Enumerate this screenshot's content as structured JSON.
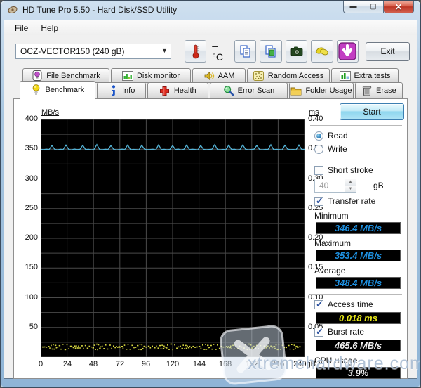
{
  "window": {
    "title": "HD Tune Pro 5.50 - Hard Disk/SSD Utility"
  },
  "menu": {
    "items": [
      "File",
      "Help"
    ]
  },
  "toolbar": {
    "drive": "OCZ-VECTOR150 (240 gB)",
    "temperature": "– °C",
    "exit_label": "Exit"
  },
  "tabs_row1": [
    {
      "id": "file-benchmark",
      "label": "File Benchmark",
      "icon": "lamp-purple",
      "active": false
    },
    {
      "id": "disk-monitor",
      "label": "Disk monitor",
      "icon": "chart-bars",
      "active": false
    },
    {
      "id": "aam",
      "label": "AAM",
      "icon": "speaker",
      "active": false
    },
    {
      "id": "random-access",
      "label": "Random Access",
      "icon": "dots",
      "active": false
    },
    {
      "id": "extra-tests",
      "label": "Extra tests",
      "icon": "chart-green",
      "active": false
    }
  ],
  "tabs_row2": [
    {
      "id": "benchmark",
      "label": "Benchmark",
      "icon": "lamp-yellow",
      "active": true
    },
    {
      "id": "info",
      "label": "Info",
      "icon": "info",
      "active": false
    },
    {
      "id": "health",
      "label": "Health",
      "icon": "health-cross",
      "active": false
    },
    {
      "id": "error-scan",
      "label": "Error Scan",
      "icon": "magnifier",
      "active": false
    },
    {
      "id": "folder-usage",
      "label": "Folder Usage",
      "icon": "folder",
      "active": false
    },
    {
      "id": "erase",
      "label": "Erase",
      "icon": "trash",
      "active": false
    }
  ],
  "results": {
    "start_label": "Start",
    "read_label": "Read",
    "read_checked": true,
    "write_label": "Write",
    "write_checked": false,
    "short_stroke_label": "Short stroke",
    "short_stroke_checked": false,
    "capacity_value": "40",
    "capacity_unit": "gB",
    "transfer_rate_label": "Transfer rate",
    "transfer_rate_checked": true,
    "minimum_label": "Minimum",
    "minimum_value": "346.4 MB/s",
    "maximum_label": "Maximum",
    "maximum_value": "353.4 MB/s",
    "average_label": "Average",
    "average_value": "348.4 MB/s",
    "access_time_label": "Access time",
    "access_time_checked": true,
    "access_time_value": "0.018 ms",
    "burst_rate_label": "Burst rate",
    "burst_rate_checked": true,
    "burst_rate_value": "465.6 MB/s",
    "cpu_usage_label": "CPU usage",
    "cpu_usage_value": "3.9%"
  },
  "watermark": {
    "text": "xtremehardware.com"
  },
  "chart_data": {
    "type": "line",
    "x_unit": "gB",
    "xlim": [
      0,
      240
    ],
    "x_ticks": [
      0,
      24,
      48,
      72,
      96,
      120,
      144,
      168,
      192,
      216,
      240
    ],
    "left_axis": {
      "label": "MB/s",
      "lim": [
        0,
        400
      ],
      "ticks": [
        400,
        350,
        300,
        250,
        200,
        150,
        100,
        50
      ]
    },
    "right_axis": {
      "label": "ms",
      "lim": [
        0,
        0.4
      ],
      "ticks": [
        "0.40",
        "0.35",
        "0.30",
        "0.25",
        "0.20",
        "0.15",
        "0.10",
        "0.05"
      ]
    },
    "grid": {
      "x_step": 24,
      "y_left_step": 25
    },
    "series": [
      {
        "name": "transfer_rate",
        "axis": "left",
        "style": "line",
        "color": "#54b4d8",
        "unit": "MB/s",
        "values": [
          349.8,
          349.2,
          350.1,
          349.5,
          356.2,
          349.7,
          349.0,
          349.9,
          349.4,
          357.1,
          349.6,
          348.8,
          350.2,
          349.3,
          349.8,
          356.5,
          349.2,
          349.9,
          348.9,
          349.6,
          357.8,
          349.4,
          349.1,
          350.0,
          349.5,
          356.0,
          349.8,
          348.7,
          349.3,
          350.1,
          349.6,
          357.2,
          349.0,
          349.7,
          349.4,
          348.8,
          356.6,
          349.9,
          349.2,
          349.5,
          350.0,
          348.9,
          357.4,
          349.3,
          349.8,
          349.1,
          349.6,
          356.1,
          349.4,
          350.2,
          348.8,
          349.7,
          357.0,
          349.2,
          349.9,
          349.5,
          348.7,
          356.3,
          349.8,
          349.1,
          349.6,
          350.0,
          357.6,
          349.3,
          348.9,
          349.7,
          349.2,
          356.8,
          349.5,
          349.9,
          348.8,
          349.4,
          357.1,
          349.8,
          349.0,
          349.6,
          350.1,
          356.2,
          349.3,
          348.9,
          349.7,
          349.5,
          357.5,
          349.1,
          349.8,
          349.4,
          348.8,
          356.4,
          350.0,
          349.2,
          349.6,
          349.0,
          357.0,
          349.5,
          349.8
        ]
      },
      {
        "name": "access_time",
        "axis": "right",
        "style": "dots",
        "color": "#d6d640",
        "unit": "ms",
        "value": 0.018,
        "spread": 0.004
      }
    ]
  }
}
